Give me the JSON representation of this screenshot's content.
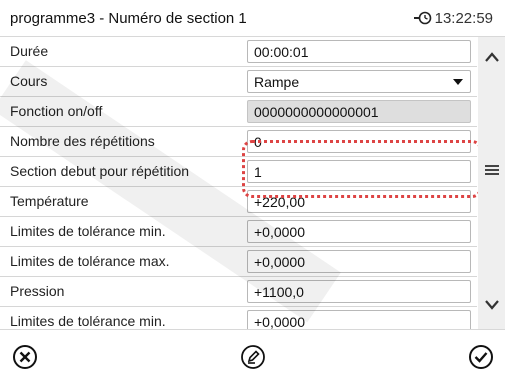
{
  "header": {
    "title": "programme3 - Numéro de section 1",
    "time": "13:22:59"
  },
  "rows": [
    {
      "label": "Durée",
      "value": "00:00:01"
    },
    {
      "label": "Cours",
      "value": "Rampe"
    },
    {
      "label": "Fonction on/off",
      "value": "0000000000000001"
    },
    {
      "label": "Nombre des répétitions",
      "value": "0"
    },
    {
      "label": "Section debut pour répétition",
      "value": "1"
    },
    {
      "label": "Température",
      "value": "+220,00"
    },
    {
      "label": "Limites de tolérance min.",
      "value": "+0,0000"
    },
    {
      "label": "Limites de tolérance max.",
      "value": "+0,0000"
    },
    {
      "label": "Pression",
      "value": "+1100,0"
    },
    {
      "label": "Limites de tolérance min.",
      "value": "+0,0000"
    }
  ],
  "icons": {
    "clock": "clock-icon",
    "scroll_up": "chevron-up-icon",
    "menu": "menu-icon",
    "scroll_down": "chevron-down-icon",
    "cancel": "close-circle-icon",
    "edit": "edit-pencil-icon",
    "confirm": "check-circle-icon"
  },
  "colors": {
    "highlight": "#d44444",
    "disabled_field": "#dedede",
    "scrollbar": "#efefef"
  }
}
